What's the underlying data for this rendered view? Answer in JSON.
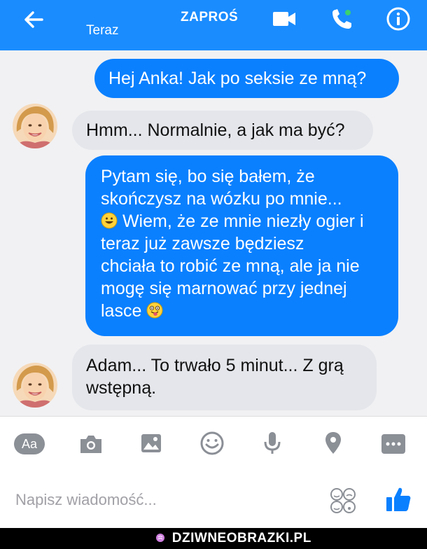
{
  "header": {
    "back_icon": "arrow-left-icon",
    "status": "Teraz",
    "invite_label": "ZAPROŚ",
    "video_icon": "video-camera-icon",
    "call_icon": "phone-call-icon",
    "info_icon": "info-icon",
    "bg_color": "#1a8cfe"
  },
  "messages": [
    {
      "side": "out",
      "text": "Hej Anka! Jak po seksie ze mną?"
    },
    {
      "side": "in",
      "text": "Hmm... Normalnie, a jak ma być?"
    },
    {
      "side": "out",
      "lines": [
        "Pytam się, bo się bałem, że",
        "skończysz na wózku po mnie...",
        "Wiem, że ze mnie niezły ogier i",
        "teraz już zawsze będziesz",
        "chciała to robić ze mną, ale ja nie",
        "mogę się marnować przy jednej",
        "lasce"
      ],
      "emoji_1": "grinning-emoji",
      "emoji_2": "tongue-out-emoji"
    },
    {
      "side": "in",
      "lines": [
        "Adam... To trwało 5 minut... Z grą",
        "wstępną."
      ]
    }
  ],
  "composer": {
    "icons": [
      "text-style-icon",
      "camera-icon",
      "image-icon",
      "smiley-icon",
      "microphone-icon",
      "location-icon",
      "more-icon"
    ],
    "aa_label": "Aa",
    "placeholder": "Napisz wiadomość...",
    "stickers_icon": "stickers-icon",
    "like_icon": "thumbs-up-icon"
  },
  "watermark": "DZIWNEOBRAZKI.PL"
}
